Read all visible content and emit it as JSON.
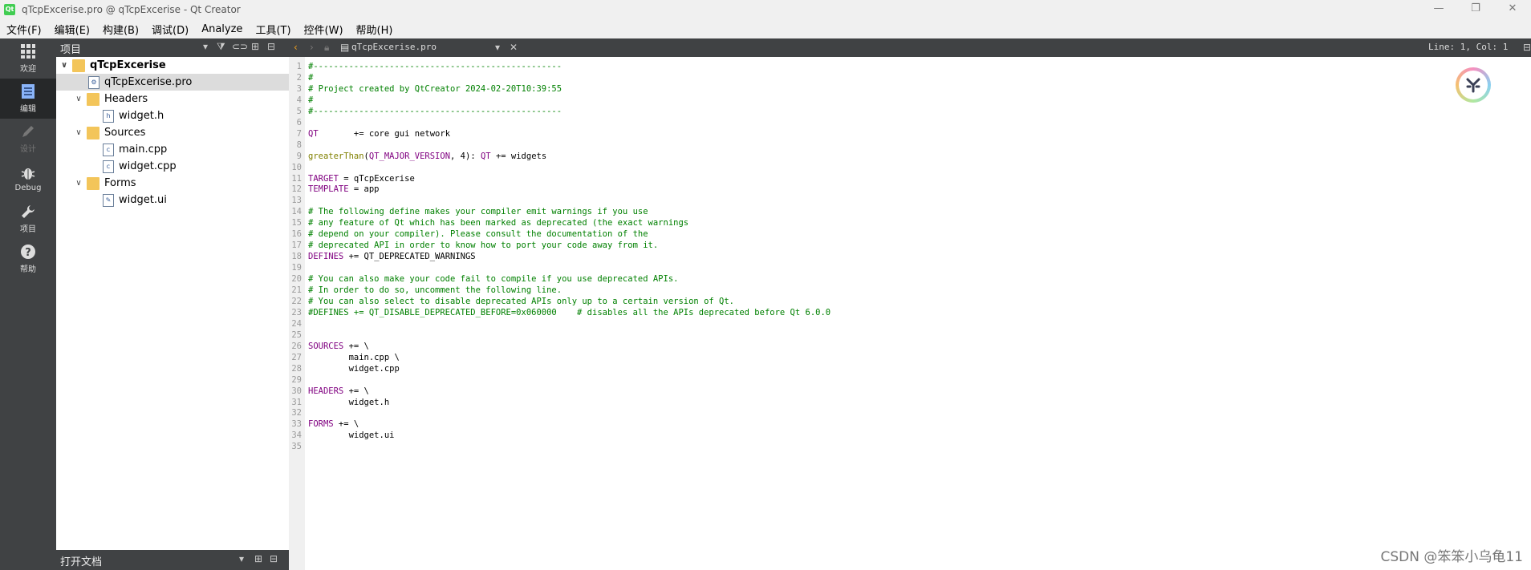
{
  "window": {
    "title": "qTcpExcerise.pro @ qTcpExcerise - Qt Creator",
    "controls": [
      "—",
      "❐",
      "✕"
    ]
  },
  "menu": [
    "文件(F)",
    "编辑(E)",
    "构建(B)",
    "调试(D)",
    "Analyze",
    "工具(T)",
    "控件(W)",
    "帮助(H)"
  ],
  "modes": [
    {
      "label": "欢迎",
      "icon": "grid-icon"
    },
    {
      "label": "编辑",
      "icon": "document-icon"
    },
    {
      "label": "设计",
      "icon": "pencil-icon"
    },
    {
      "label": "Debug",
      "icon": "bug-icon"
    },
    {
      "label": "项目",
      "icon": "wrench-icon"
    },
    {
      "label": "帮助",
      "icon": "help-icon"
    }
  ],
  "project_pane": {
    "title": "项目"
  },
  "tree": [
    {
      "label": "qTcpExcerise",
      "depth": 0,
      "expanded": true,
      "kind": "project"
    },
    {
      "label": "qTcpExcerise.pro",
      "depth": 1,
      "kind": "pro-file",
      "selected": true
    },
    {
      "label": "Headers",
      "depth": 1,
      "expanded": true,
      "kind": "folder"
    },
    {
      "label": "widget.h",
      "depth": 2,
      "kind": "h-file"
    },
    {
      "label": "Sources",
      "depth": 1,
      "expanded": true,
      "kind": "folder"
    },
    {
      "label": "main.cpp",
      "depth": 2,
      "kind": "cpp-file"
    },
    {
      "label": "widget.cpp",
      "depth": 2,
      "kind": "cpp-file"
    },
    {
      "label": "Forms",
      "depth": 1,
      "expanded": true,
      "kind": "folder"
    },
    {
      "label": "widget.ui",
      "depth": 2,
      "kind": "ui-file"
    }
  ],
  "open_docs": {
    "title": "打开文档"
  },
  "editor": {
    "file_tab": "qTcpExcerise.pro",
    "cursor_pos": "Line: 1, Col: 1",
    "lines": [
      {
        "n": "1",
        "segs": [
          {
            "t": "#-------------------------------------------------",
            "c": "cm"
          }
        ]
      },
      {
        "n": "2",
        "segs": [
          {
            "t": "#",
            "c": "cm"
          }
        ]
      },
      {
        "n": "3",
        "segs": [
          {
            "t": "# Project created by QtCreator 2024-02-20T10:39:55",
            "c": "cm"
          }
        ]
      },
      {
        "n": "4",
        "segs": [
          {
            "t": "#",
            "c": "cm"
          }
        ]
      },
      {
        "n": "5",
        "segs": [
          {
            "t": "#-------------------------------------------------",
            "c": "cm"
          }
        ]
      },
      {
        "n": "6",
        "segs": []
      },
      {
        "n": "7",
        "segs": [
          {
            "t": "QT",
            "c": "kw"
          },
          {
            "t": "       += core gui network",
            "c": ""
          }
        ]
      },
      {
        "n": "8",
        "segs": []
      },
      {
        "n": "9",
        "segs": [
          {
            "t": "greaterThan",
            "c": "fn"
          },
          {
            "t": "(",
            "c": ""
          },
          {
            "t": "QT_MAJOR_VERSION",
            "c": "kw"
          },
          {
            "t": ", 4): ",
            "c": ""
          },
          {
            "t": "QT",
            "c": "kw"
          },
          {
            "t": " += widgets",
            "c": ""
          }
        ]
      },
      {
        "n": "10",
        "segs": []
      },
      {
        "n": "11",
        "segs": [
          {
            "t": "TARGET",
            "c": "kw"
          },
          {
            "t": " = qTcpExcerise",
            "c": ""
          }
        ]
      },
      {
        "n": "12",
        "segs": [
          {
            "t": "TEMPLATE",
            "c": "kw"
          },
          {
            "t": " = app",
            "c": ""
          }
        ]
      },
      {
        "n": "13",
        "segs": []
      },
      {
        "n": "14",
        "segs": [
          {
            "t": "# The following define makes your compiler emit warnings if you use",
            "c": "cm"
          }
        ]
      },
      {
        "n": "15",
        "segs": [
          {
            "t": "# any feature of Qt which has been marked as deprecated (the exact warnings",
            "c": "cm"
          }
        ]
      },
      {
        "n": "16",
        "segs": [
          {
            "t": "# depend on your compiler). Please consult the documentation of the",
            "c": "cm"
          }
        ]
      },
      {
        "n": "17",
        "segs": [
          {
            "t": "# deprecated API in order to know how to port your code away from it.",
            "c": "cm"
          }
        ]
      },
      {
        "n": "18",
        "segs": [
          {
            "t": "DEFINES",
            "c": "kw"
          },
          {
            "t": " += QT_DEPRECATED_WARNINGS",
            "c": ""
          }
        ]
      },
      {
        "n": "19",
        "segs": []
      },
      {
        "n": "20",
        "segs": [
          {
            "t": "# You can also make your code fail to compile if you use deprecated APIs.",
            "c": "cm"
          }
        ]
      },
      {
        "n": "21",
        "segs": [
          {
            "t": "# In order to do so, uncomment the following line.",
            "c": "cm"
          }
        ]
      },
      {
        "n": "22",
        "segs": [
          {
            "t": "# You can also select to disable deprecated APIs only up to a certain version of Qt.",
            "c": "cm"
          }
        ]
      },
      {
        "n": "23",
        "segs": [
          {
            "t": "#DEFINES += QT_DISABLE_DEPRECATED_BEFORE=0x060000    # disables all the APIs deprecated before Qt 6.0.0",
            "c": "cm"
          }
        ]
      },
      {
        "n": "24",
        "segs": []
      },
      {
        "n": "25",
        "segs": []
      },
      {
        "n": "26",
        "segs": [
          {
            "t": "SOURCES",
            "c": "kw"
          },
          {
            "t": " += \\",
            "c": ""
          }
        ]
      },
      {
        "n": "27",
        "segs": [
          {
            "t": "        main.cpp \\",
            "c": ""
          }
        ]
      },
      {
        "n": "28",
        "segs": [
          {
            "t": "        widget.cpp",
            "c": ""
          }
        ]
      },
      {
        "n": "29",
        "segs": []
      },
      {
        "n": "30",
        "segs": [
          {
            "t": "HEADERS",
            "c": "kw"
          },
          {
            "t": " += \\",
            "c": ""
          }
        ]
      },
      {
        "n": "31",
        "segs": [
          {
            "t": "        widget.h",
            "c": ""
          }
        ]
      },
      {
        "n": "32",
        "segs": []
      },
      {
        "n": "33",
        "segs": [
          {
            "t": "FORMS",
            "c": "kw"
          },
          {
            "t": " += \\",
            "c": ""
          }
        ]
      },
      {
        "n": "34",
        "segs": [
          {
            "t": "        widget.ui",
            "c": ""
          }
        ]
      },
      {
        "n": "35",
        "segs": []
      }
    ]
  },
  "watermark": "CSDN @笨笨小乌龟11"
}
